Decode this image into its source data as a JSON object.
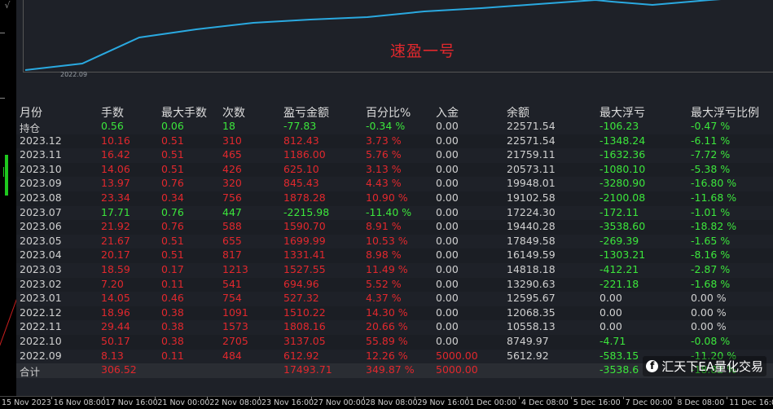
{
  "colors": {
    "background": "#1e2128",
    "header_text": "#dcdcdc",
    "gain_red": "#e1282d",
    "green": "#3ce63c",
    "neutral": "#d0d0d0",
    "equity_line": "#2aa9e0"
  },
  "chart": {
    "title": "速盈一号",
    "x_label": "2022.09"
  },
  "table": {
    "headers": [
      "月份",
      "手数",
      "最大手数",
      "次数",
      "盈亏金额",
      "百分比%",
      "入金",
      "余额",
      "最大浮亏",
      "最大浮亏比例"
    ],
    "rows": [
      [
        "持仓",
        "0.56",
        "0.06",
        "18",
        "-77.83",
        "-0.34 %",
        "0.00",
        "22571.54",
        "-106.23",
        "-0.47 %"
      ],
      [
        "2023.12",
        "10.16",
        "0.51",
        "310",
        "812.43",
        "3.73 %",
        "0.00",
        "22571.54",
        "-1348.24",
        "-6.11 %"
      ],
      [
        "2023.11",
        "16.42",
        "0.51",
        "465",
        "1186.00",
        "5.76 %",
        "0.00",
        "21759.11",
        "-1632.36",
        "-7.72 %"
      ],
      [
        "2023.10",
        "14.06",
        "0.51",
        "426",
        "625.10",
        "3.13 %",
        "0.00",
        "20573.11",
        "-1080.10",
        "-5.38 %"
      ],
      [
        "2023.09",
        "13.97",
        "0.76",
        "320",
        "845.43",
        "4.43 %",
        "0.00",
        "19948.01",
        "-3280.90",
        "-16.80 %"
      ],
      [
        "2023.08",
        "23.34",
        "0.34",
        "756",
        "1878.28",
        "10.90 %",
        "0.00",
        "19102.58",
        "-2100.08",
        "-11.68 %"
      ],
      [
        "2023.07",
        "17.71",
        "0.76",
        "447",
        "-2215.98",
        "-11.40 %",
        "0.00",
        "17224.30",
        "-172.11",
        "-1.01 %"
      ],
      [
        "2023.06",
        "21.92",
        "0.76",
        "588",
        "1590.70",
        "8.91 %",
        "0.00",
        "19440.28",
        "-3538.60",
        "-18.82 %"
      ],
      [
        "2023.05",
        "21.67",
        "0.51",
        "655",
        "1699.99",
        "10.53 %",
        "0.00",
        "17849.58",
        "-269.39",
        "-1.65 %"
      ],
      [
        "2023.04",
        "20.17",
        "0.51",
        "817",
        "1331.41",
        "8.98 %",
        "0.00",
        "16149.59",
        "-1303.21",
        "-8.16 %"
      ],
      [
        "2023.03",
        "18.59",
        "0.17",
        "1213",
        "1527.55",
        "11.49 %",
        "0.00",
        "14818.18",
        "-412.21",
        "-2.87 %"
      ],
      [
        "2023.02",
        "7.20",
        "0.11",
        "541",
        "694.96",
        "5.52 %",
        "0.00",
        "13290.63",
        "-221.18",
        "-1.68 %"
      ],
      [
        "2023.01",
        "14.05",
        "0.46",
        "754",
        "527.32",
        "4.37 %",
        "0.00",
        "12595.67",
        "0.00",
        "0.00 %"
      ],
      [
        "2022.12",
        "18.96",
        "0.38",
        "1091",
        "1510.22",
        "14.30 %",
        "0.00",
        "12068.35",
        "0.00",
        "0.00 %"
      ],
      [
        "2022.11",
        "29.44",
        "0.38",
        "1573",
        "1808.16",
        "20.66 %",
        "0.00",
        "10558.13",
        "0.00",
        "0.00 %"
      ],
      [
        "2022.10",
        "50.17",
        "0.38",
        "2705",
        "3137.05",
        "55.89 %",
        "0.00",
        "8749.97",
        "-4.71",
        "-0.08 %"
      ],
      [
        "2022.09",
        "8.13",
        "0.11",
        "484",
        "612.92",
        "12.26 %",
        "5000.00",
        "5612.92",
        "-583.15",
        "-11.20 %"
      ]
    ],
    "total_row": [
      "合计",
      "306.52",
      "",
      "",
      "17493.71",
      "349.87 %",
      "5000.00",
      "",
      "-3538.6",
      "-18.82 %"
    ]
  },
  "watermark": {
    "icon": "facebook-icon",
    "text": "汇天下EA量化交易"
  },
  "time_axis": [
    "15 Nov 2023",
    "16 Nov 08:00",
    "17 Nov 16:00",
    "21 Nov 00:00",
    "22 Nov 08:00",
    "23 Nov 16:00",
    "27 Nov 00:00",
    "28 Nov 08:00",
    "29 Nov 16:00",
    "1 Dec 00:00",
    "4 Dec 08:00",
    "5 Dec 16:00",
    "7 Dec 00:00",
    "8 Dec 08:00",
    "11 Dec 16:00"
  ],
  "top_indicator": "√"
}
